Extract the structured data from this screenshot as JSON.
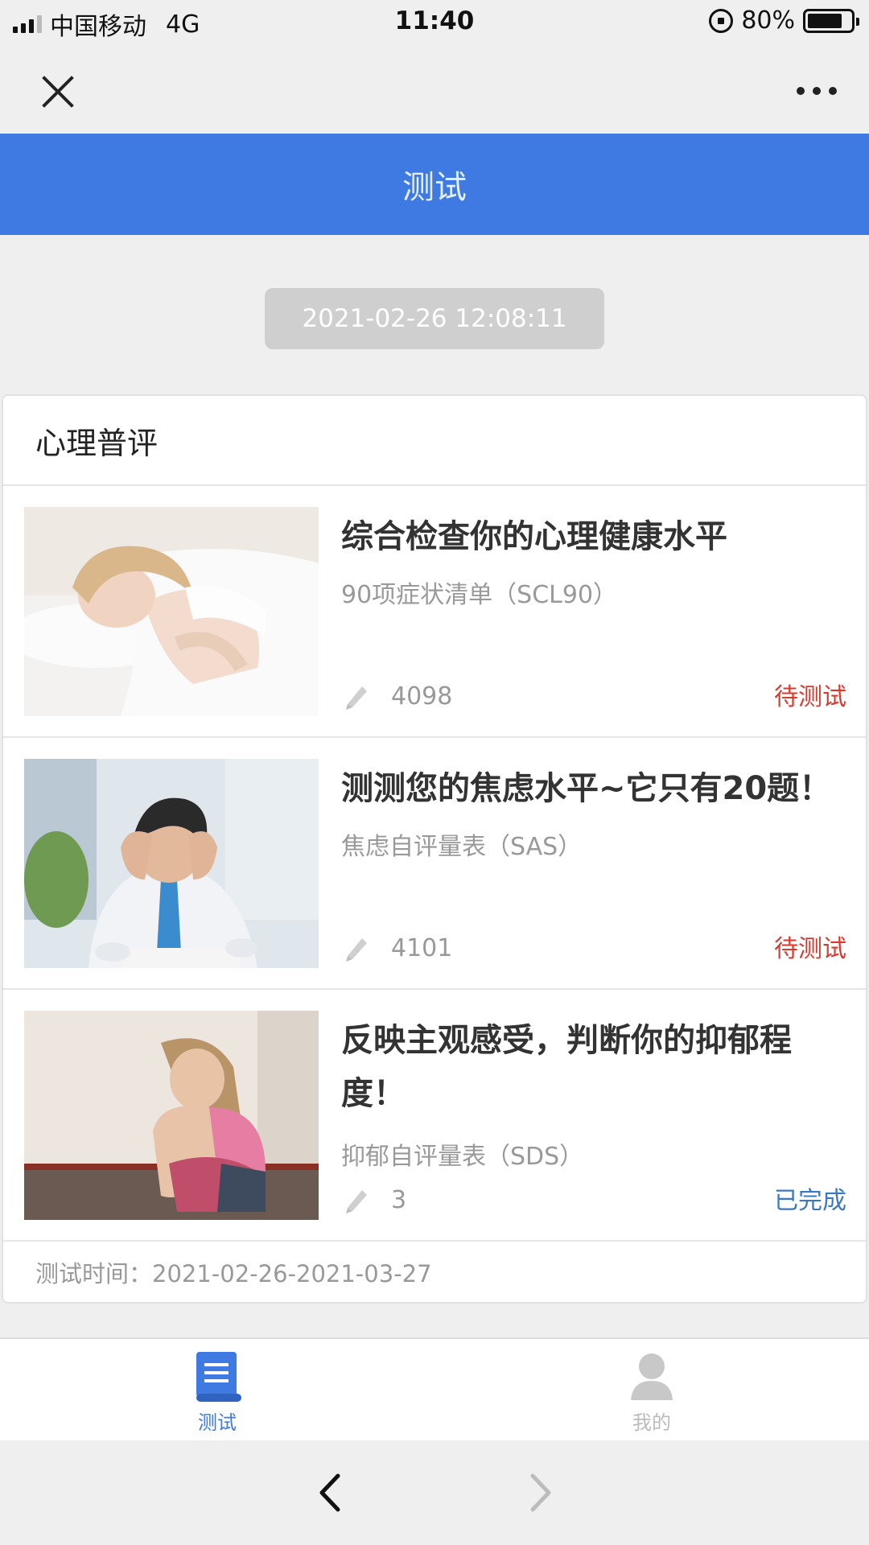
{
  "status_bar": {
    "carrier": "中国移动",
    "network": "4G",
    "time": "11:40",
    "battery": "80%",
    "battery_level": 0.8
  },
  "header": {
    "title": "测试",
    "accent_color": "#3e7ae1"
  },
  "date_badge": "2021-02-26 12:08:11",
  "section": {
    "title": "心理普评",
    "items": [
      {
        "title": "综合检查你的心理健康水平",
        "subtitle": "90项症状清单（SCL90）",
        "count": "4098",
        "status": "待测试",
        "image": "woman-sleeping-photo"
      },
      {
        "title": "测测您的焦虑水平~它只有20题！",
        "subtitle": "焦虑自评量表（SAS）",
        "count": "4101",
        "status": "待测试",
        "image": "stressed-man-photo"
      },
      {
        "title": "反映主观感受，判断你的抑郁程度！",
        "subtitle": "抑郁自评量表（SDS）",
        "count": "3",
        "status": "已完成",
        "image": "sad-girl-photo"
      }
    ],
    "footer": "测试时间：2021-02-26-2021-03-27"
  },
  "tabbar": {
    "tabs": [
      {
        "label": "测试",
        "icon": "book-icon",
        "active": true
      },
      {
        "label": "我的",
        "icon": "user-icon",
        "active": false
      }
    ]
  },
  "status_colors": {
    "pending": "#d93a2f",
    "done": "#3b78c2"
  }
}
